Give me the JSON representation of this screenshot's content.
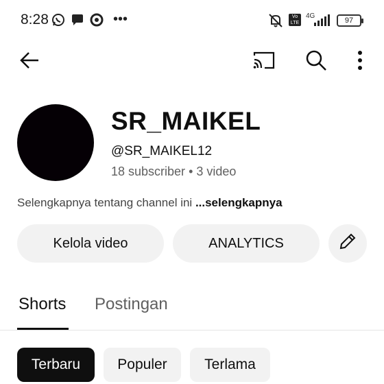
{
  "status_bar": {
    "time": "8:28",
    "network": "4G",
    "volte": "Vo LTE",
    "battery": "97",
    "icons": [
      "whatsapp-icon",
      "chat-bubble-icon",
      "chrome-icon",
      "more-notifications-icon",
      "muted-bell-icon",
      "volte-icon",
      "signal-icon",
      "battery-icon"
    ]
  },
  "topbar": {
    "icons": [
      "back-arrow-icon",
      "cast-icon",
      "search-icon",
      "more-vertical-icon"
    ]
  },
  "channel": {
    "name": "SR_MAIKEL",
    "handle": "@SR_MAIKEL12",
    "subscribers": "18 subscriber",
    "separator": "•",
    "videos": "3 video",
    "about_text": "Selengkapnya tentang channel ini",
    "about_more": "...selengkapnya"
  },
  "actions": {
    "manage_videos": "Kelola video",
    "analytics": "ANALYTICS",
    "edit_icon": "pencil-icon"
  },
  "tabs": [
    {
      "label": "Shorts",
      "active": true
    },
    {
      "label": "Postingan",
      "active": false
    }
  ],
  "chips": [
    {
      "label": "Terbaru",
      "selected": true
    },
    {
      "label": "Populer",
      "selected": false
    },
    {
      "label": "Terlama",
      "selected": false
    }
  ],
  "colors": {
    "text_primary": "#0f0f0f",
    "text_secondary": "#606060",
    "chip_bg": "#f2f2f2",
    "avatar": "#050005"
  }
}
